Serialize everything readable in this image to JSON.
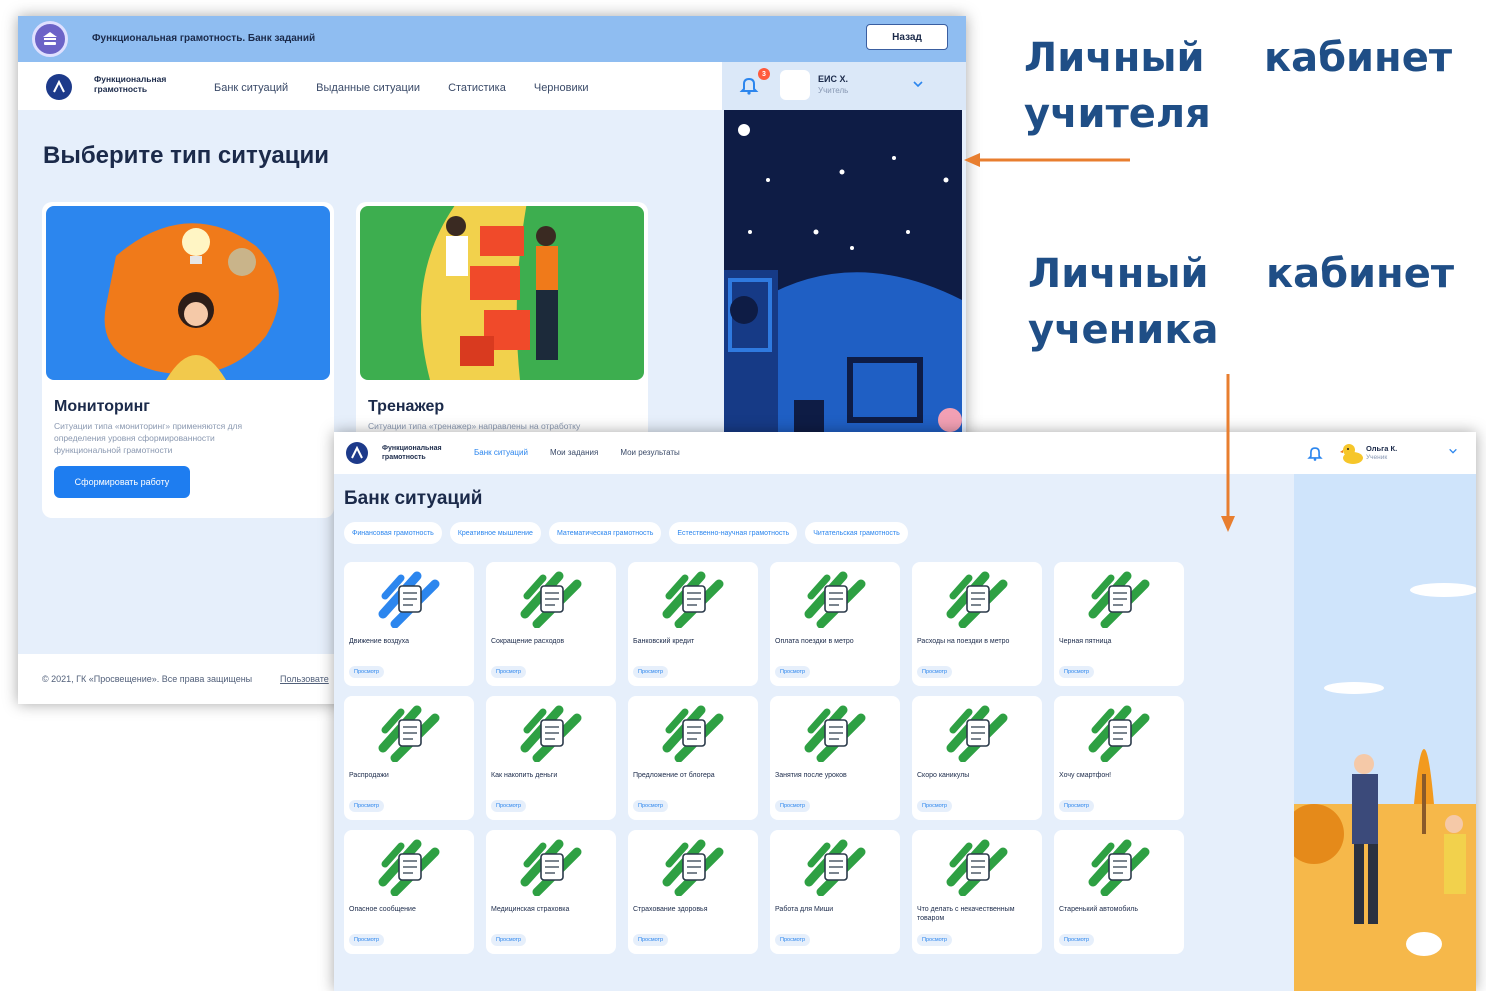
{
  "annotations": {
    "teacher": {
      "line1_a": "Личный",
      "line1_b": "кабинет",
      "line2": "учителя"
    },
    "student": {
      "line1_a": "Личный",
      "line1_b": "кабинет",
      "line2": "ученика"
    },
    "arrow_color": "#e87e2f",
    "text_color": "#1f4e86"
  },
  "teacher_window": {
    "title_bar": {
      "title": "Функциональная грамотность. Банк заданий",
      "back_button": "Назад"
    },
    "brand": {
      "name": "Функциональная грамотность"
    },
    "nav": [
      "Банк ситуаций",
      "Выданные ситуации",
      "Статистика",
      "Черновики"
    ],
    "user": {
      "name": "ЕИС Х.",
      "role": "Учитель",
      "notifications": "3"
    },
    "heading": "Выберите тип ситуации",
    "cards": [
      {
        "title": "Мониторинг",
        "description": "Ситуации типа «мониторинг» применяются для определения уровня сформированности функциональной грамотности",
        "button": "Сформировать работу",
        "image_color": "#2c86ee"
      },
      {
        "title": "Тренажер",
        "description": "Ситуации типа «тренажер» направлены на отработку",
        "image_color": "#3dae4f"
      }
    ],
    "footer": {
      "copyright": "© 2021, ГК «Просвещение». Все права защищены",
      "link": "Пользовате"
    }
  },
  "student_window": {
    "brand": {
      "name": "Функциональная грамотность"
    },
    "nav": [
      "Банк ситуаций",
      "Мои задания",
      "Мои результаты"
    ],
    "user": {
      "name": "Ольга К.",
      "role": "Ученик"
    },
    "heading": "Банк ситуаций",
    "filters": [
      "Финансовая грамотность",
      "Креативное мышление",
      "Математическая грамотность",
      "Естественно-научная грамотность",
      "Читательская грамотность"
    ],
    "tile_button": "Просмотр",
    "tiles": [
      {
        "label": "Движение воздуха",
        "icon": "wind-icon",
        "color": "#2c86ee"
      },
      {
        "label": "Сокращение расходов",
        "icon": "wallet-icon",
        "color": "#2ea043"
      },
      {
        "label": "Банковский кредит",
        "icon": "bank-card-icon",
        "color": "#2ea043"
      },
      {
        "label": "Оплата поездки в метро",
        "icon": "metro-icon",
        "color": "#2ea043"
      },
      {
        "label": "Расходы на поездки в метро",
        "icon": "metro-ticket-icon",
        "color": "#2ea043"
      },
      {
        "label": "Черная пятница",
        "icon": "shop-icon",
        "color": "#2ea043"
      },
      {
        "label": "Распродажи",
        "icon": "shop-sale-icon",
        "color": "#2ea043"
      },
      {
        "label": "Как накопить деньги",
        "icon": "piggy-bank-icon",
        "color": "#2ea043"
      },
      {
        "label": "Предложение от блогера",
        "icon": "blogger-icon",
        "color": "#2ea043"
      },
      {
        "label": "Занятия после уроков",
        "icon": "school-icon",
        "color": "#2ea043"
      },
      {
        "label": "Скоро каникулы",
        "icon": "calendar-icon",
        "color": "#2ea043"
      },
      {
        "label": "Хочу смартфон!",
        "icon": "smartphone-icon",
        "color": "#2ea043"
      },
      {
        "label": "Опасное сообщение",
        "icon": "phone-alert-icon",
        "color": "#2ea043"
      },
      {
        "label": "Медицинская страховка",
        "icon": "medical-document-icon",
        "color": "#2ea043"
      },
      {
        "label": "Страхование здоровья",
        "icon": "health-insurance-icon",
        "color": "#2ea043"
      },
      {
        "label": "Работа для Миши",
        "icon": "work-icon",
        "color": "#2ea043"
      },
      {
        "label": "Что делать с некачественным товаром",
        "icon": "defective-product-icon",
        "color": "#2ea043"
      },
      {
        "label": "Старенький автомобиль",
        "icon": "ruble-car-icon",
        "color": "#2ea043"
      }
    ]
  }
}
